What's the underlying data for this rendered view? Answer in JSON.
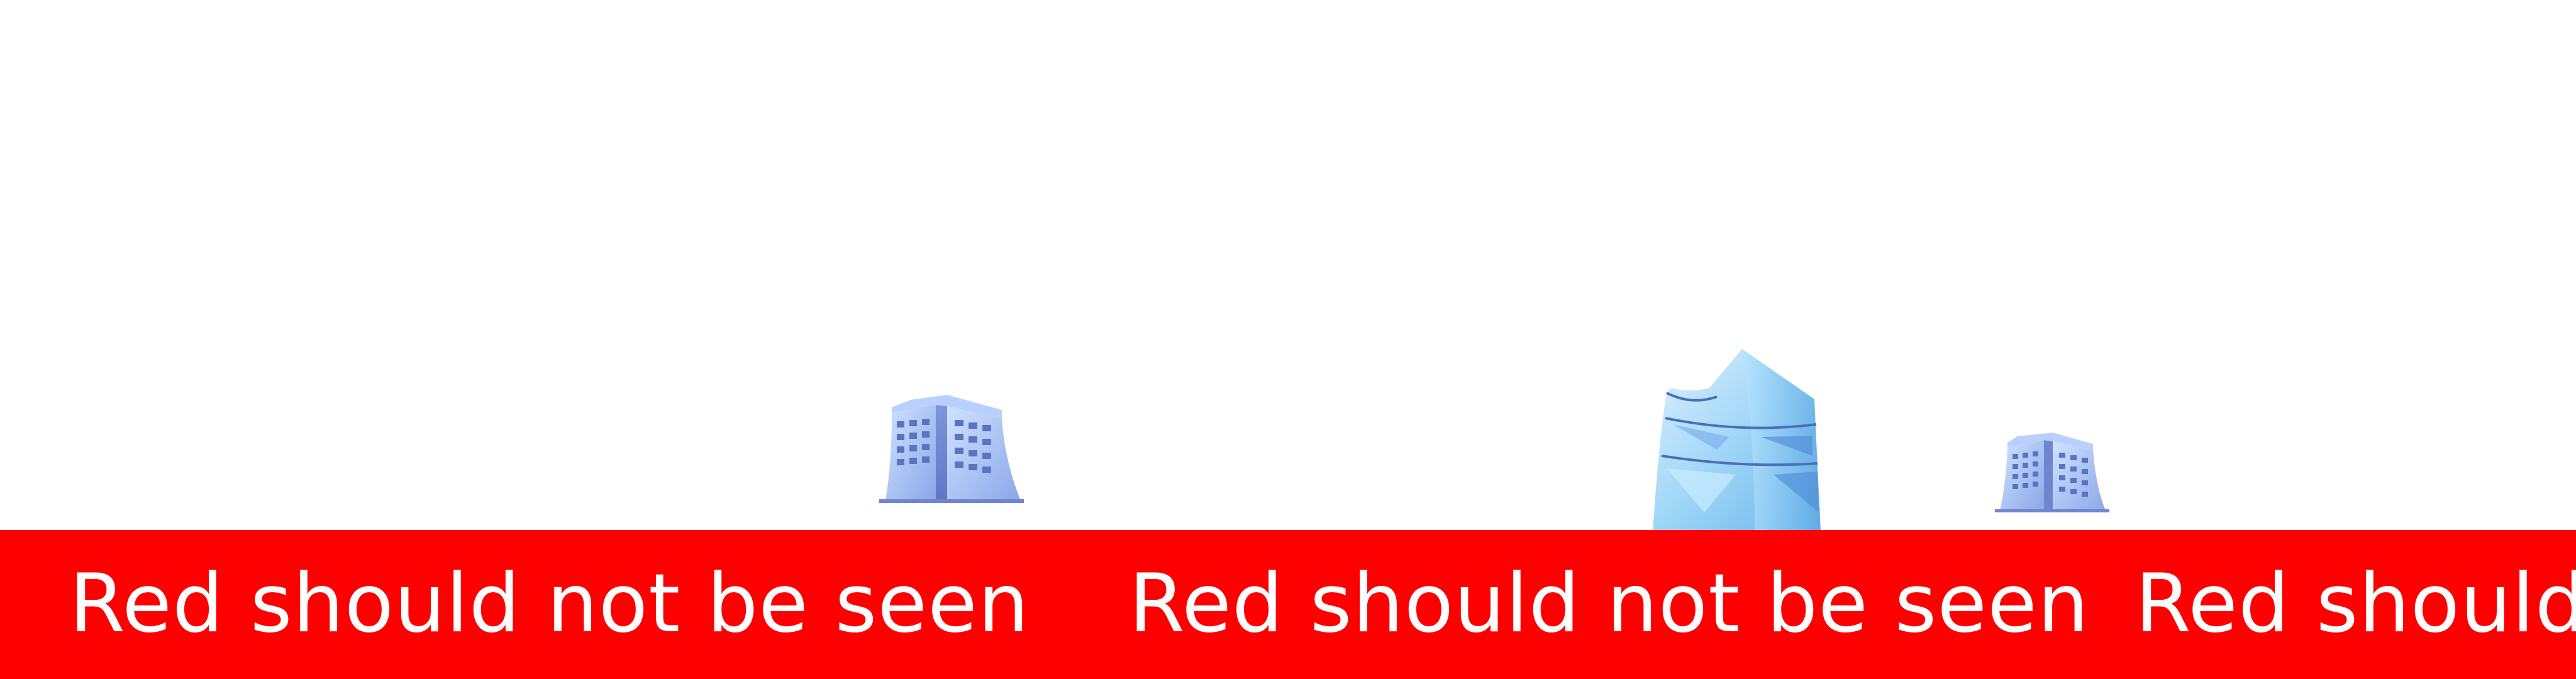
{
  "scene": {
    "background_color": "#ffffff",
    "buildings": [
      {
        "name": "small-office-building-1",
        "icon": "office-building"
      },
      {
        "name": "tall-glass-tower",
        "icon": "glass-tower"
      },
      {
        "name": "small-office-building-2",
        "icon": "office-building"
      }
    ]
  },
  "banner": {
    "color": "#ff0000",
    "text_color": "#ffffff",
    "segments": [
      "Red should not be seen",
      "Red should not be seen",
      "Red should"
    ]
  }
}
